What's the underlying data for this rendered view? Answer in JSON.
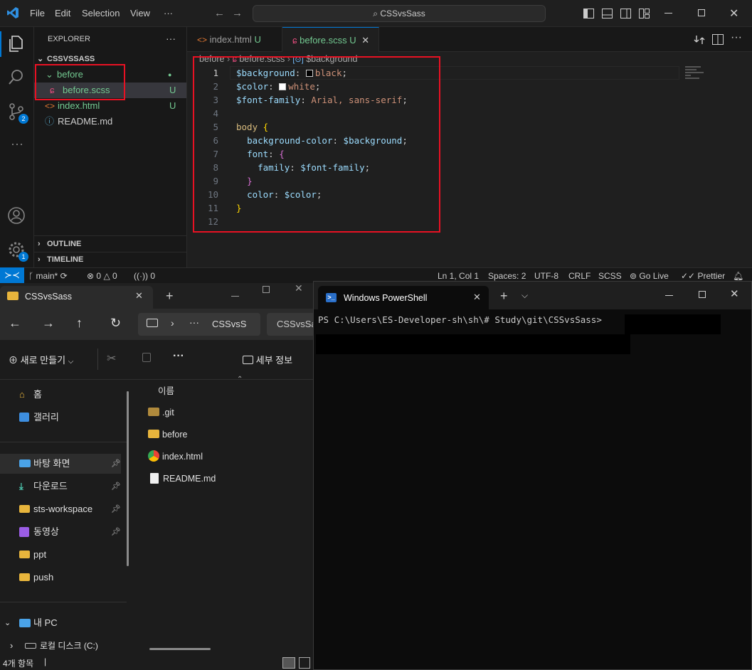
{
  "vscode": {
    "menu": [
      "File",
      "Edit",
      "Selection",
      "View",
      "···"
    ],
    "search_text": "CSSvsSass",
    "sidebar": {
      "header": "EXPLORER",
      "more": "···",
      "root": "CSSVSSASS",
      "items": [
        {
          "label": "before",
          "status": "●",
          "kind": "folder"
        },
        {
          "label": "before.scss",
          "status": "U",
          "kind": "scss"
        },
        {
          "label": "index.html",
          "status": "U",
          "kind": "html"
        },
        {
          "label": "README.md",
          "status": "",
          "kind": "info"
        }
      ],
      "outline": "OUTLINE",
      "timeline": "TIMELINE"
    },
    "activity_badges": {
      "scm": "2",
      "settings": "1"
    },
    "tabs": [
      {
        "label": "index.html",
        "status": "U",
        "active": false
      },
      {
        "label": "before.scss",
        "status": "U",
        "active": true
      }
    ],
    "breadcrumb": [
      "before",
      "before.scss",
      "$background"
    ],
    "code_lines": [
      {
        "n": "1"
      },
      {
        "n": "2"
      },
      {
        "n": "3"
      },
      {
        "n": "4"
      },
      {
        "n": "5"
      },
      {
        "n": "6"
      },
      {
        "n": "7"
      },
      {
        "n": "8"
      },
      {
        "n": "9"
      },
      {
        "n": "10"
      },
      {
        "n": "11"
      },
      {
        "n": "12"
      }
    ],
    "code": {
      "l1_var": "$background",
      "l1_val": "black",
      "l2_var": "$color",
      "l2_val": "white",
      "l3_var": "$font-family",
      "l3_val": "Arial, sans-serif",
      "l5_sel": "body",
      "l6_prop": "background-color",
      "l6_val": "$background",
      "l7_prop": "font",
      "l8_prop": "family",
      "l8_val": "$font-family",
      "l10_prop": "color",
      "l10_val": "$color"
    },
    "status": {
      "branch": "main*",
      "errors": "0",
      "warnings": "0",
      "ports": "0",
      "position": "Ln 1, Col 1",
      "spaces": "Spaces: 2",
      "encoding": "UTF-8",
      "eol": "CRLF",
      "language": "SCSS",
      "golive": "Go Live",
      "prettier": "Prettier"
    }
  },
  "file_explorer": {
    "tab_title": "CSSvsSass",
    "address": [
      "···",
      "CSSvsS",
      "CSSvsSas"
    ],
    "new_button": "새로 만들기",
    "details_button": "세부 정보",
    "column_name": "이름",
    "nav": [
      {
        "label": "홈",
        "pinned": false
      },
      {
        "label": "갤러리",
        "pinned": false
      },
      {
        "label": "바탕 화면",
        "pinned": true
      },
      {
        "label": "다운로드",
        "pinned": true
      },
      {
        "label": "sts-workspace",
        "pinned": true
      },
      {
        "label": "동영상",
        "pinned": true
      },
      {
        "label": "ppt",
        "pinned": false
      },
      {
        "label": "push",
        "pinned": false
      },
      {
        "label": "내 PC",
        "pinned": false
      },
      {
        "label": "로컬 디스크 (C:)",
        "pinned": false
      }
    ],
    "files": [
      ".git",
      "before",
      "index.html",
      "README.md"
    ],
    "status": "4개 항목"
  },
  "powershell": {
    "tab_title": "Windows PowerShell",
    "prompt": "PS C:\\Users\\ES-Developer-sh\\sh\\# Study\\git\\CSSvsSass>"
  },
  "colors": {
    "highlight_box": "#e81123",
    "accent": "#0078d4",
    "untracked": "#73c991",
    "folder": "#e8b53c"
  }
}
